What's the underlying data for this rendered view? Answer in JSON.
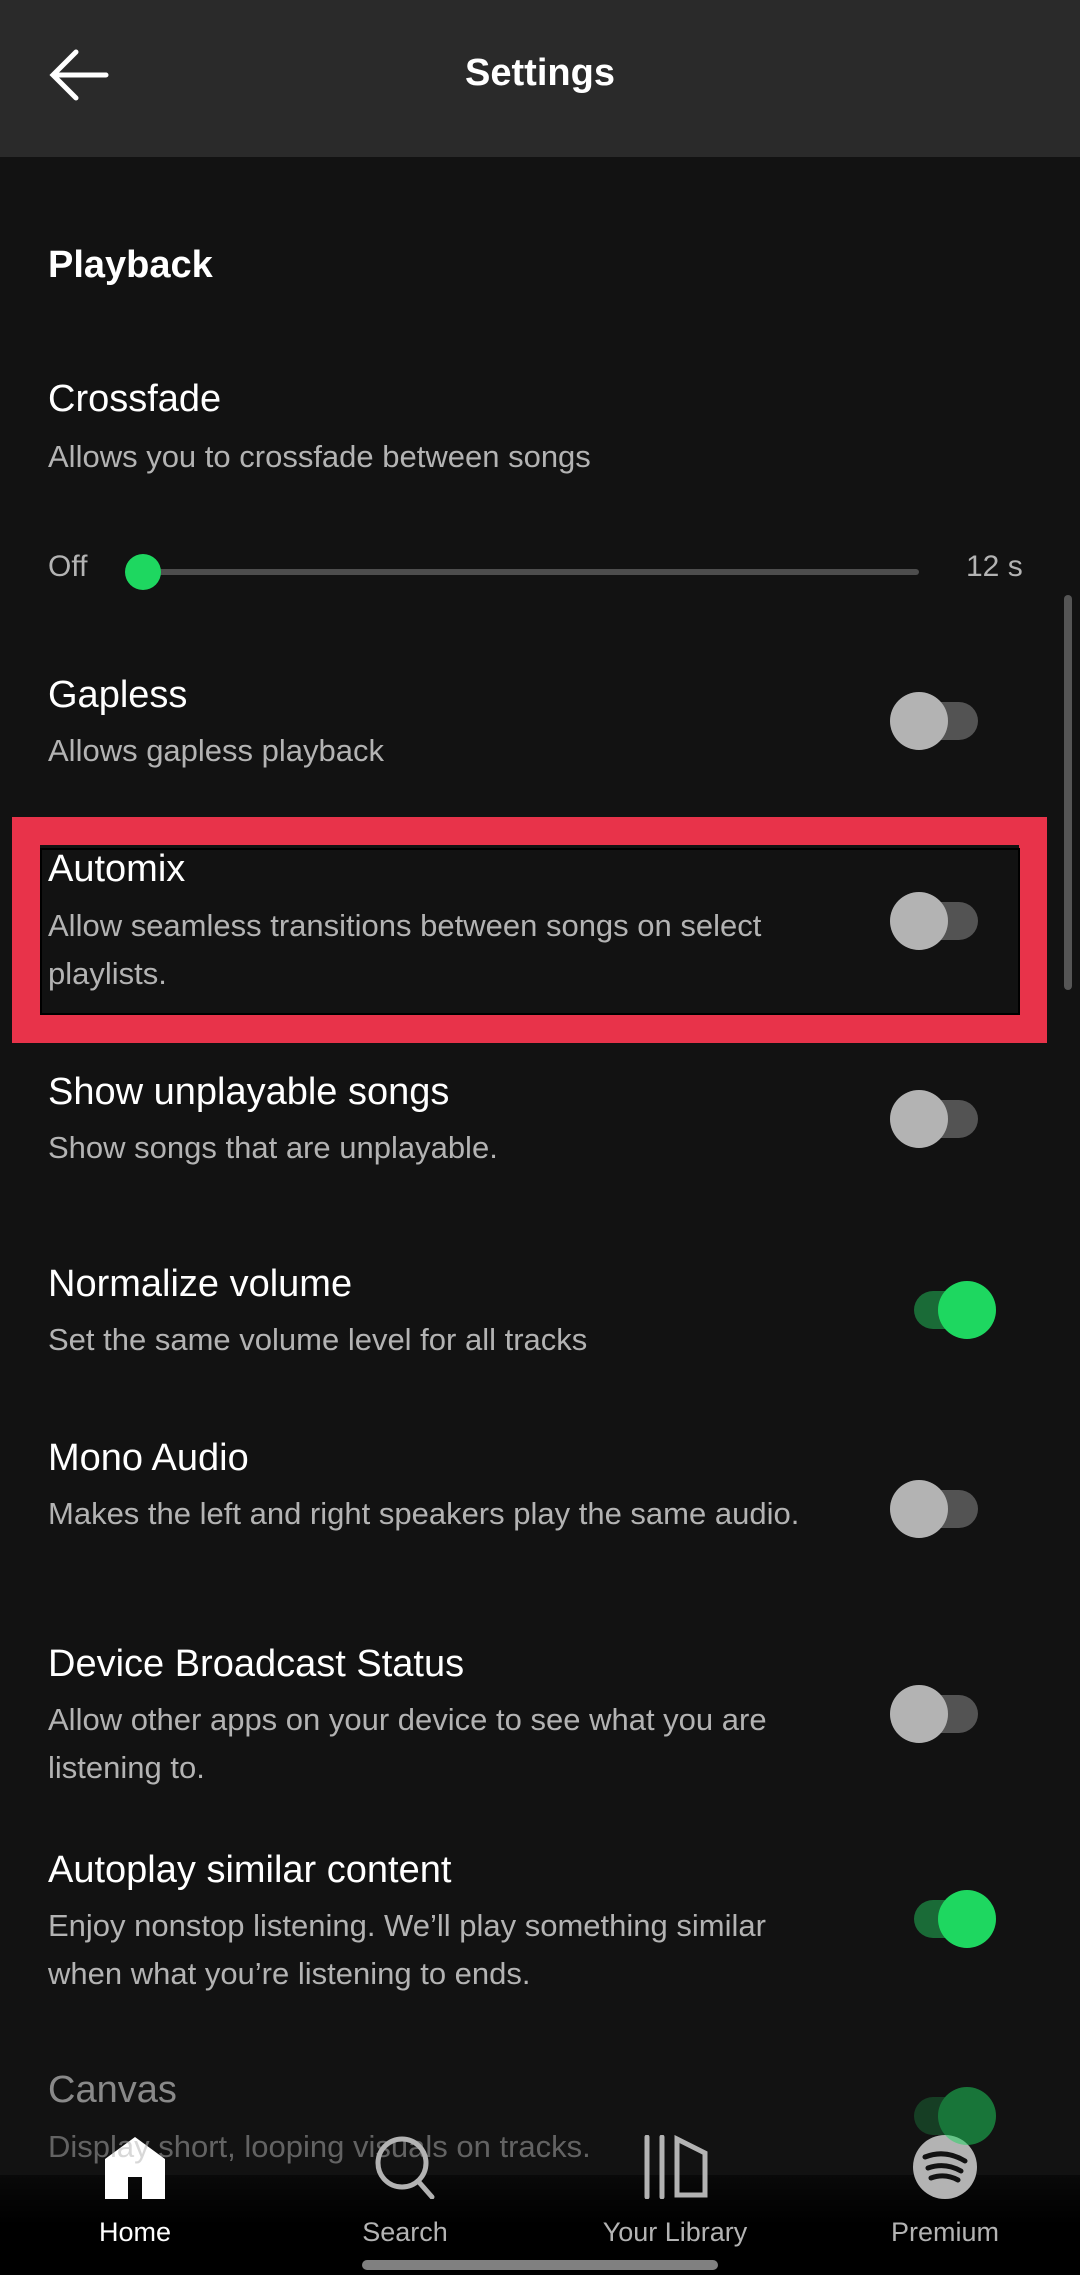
{
  "header": {
    "title": "Settings",
    "back_icon": "arrow-left-icon"
  },
  "section": "Playback",
  "crossfade": {
    "title": "Crossfade",
    "subtitle": "Allows you to crossfade between songs",
    "min_label": "Off",
    "max_label": "12 s",
    "value_seconds": 0
  },
  "settings": [
    {
      "title": "Gapless",
      "subtitle": "Allows gapless playback",
      "on": false
    },
    {
      "title": "Automix",
      "subtitle": "Allow seamless transitions between songs on select playlists.",
      "on": false,
      "highlighted": true
    },
    {
      "title": "Show unplayable songs",
      "subtitle": "Show songs that are unplayable.",
      "on": false
    },
    {
      "title": "Normalize volume",
      "subtitle": "Set the same volume level for all tracks",
      "on": true
    },
    {
      "title": "Mono Audio",
      "subtitle": "Makes the left and right speakers play the same audio.",
      "on": false
    },
    {
      "title": "Device Broadcast Status",
      "subtitle": "Allow other apps on your device to see what you are listening to.",
      "on": false
    },
    {
      "title": "Autoplay similar content",
      "subtitle": "Enjoy nonstop listening. We’ll play something similar when what you’re listening to ends.",
      "on": true
    },
    {
      "title": "Canvas",
      "subtitle": "Display short, looping visuals on tracks.",
      "on": true
    }
  ],
  "nav": [
    {
      "label": "Home",
      "icon": "home-icon",
      "active": true
    },
    {
      "label": "Search",
      "icon": "search-icon",
      "active": false
    },
    {
      "label": "Your Library",
      "icon": "library-icon",
      "active": false
    },
    {
      "label": "Premium",
      "icon": "spotify-icon",
      "active": false
    }
  ],
  "colors": {
    "accent": "#1ed760",
    "highlight": "#e8334a",
    "background": "#121212"
  }
}
